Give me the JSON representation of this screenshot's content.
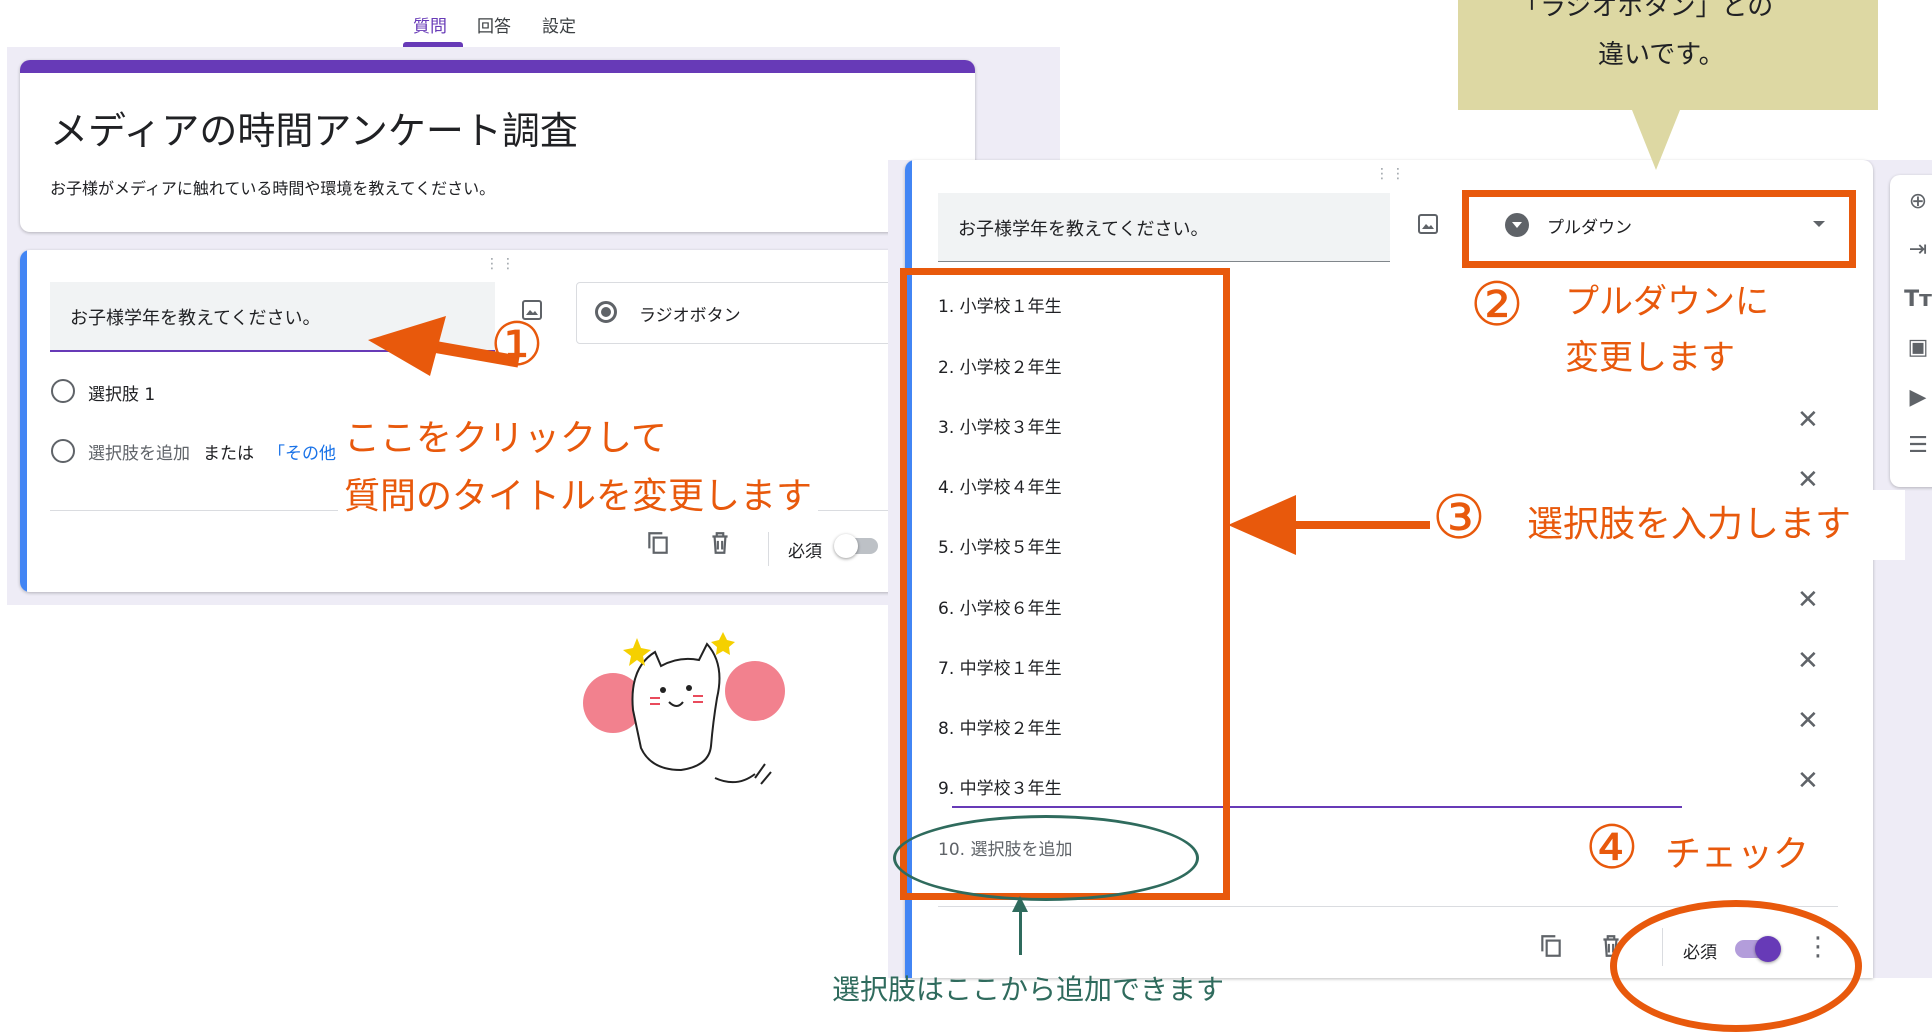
{
  "tabs": [
    {
      "label": "質問",
      "active": true
    },
    {
      "label": "回答",
      "active": false
    },
    {
      "label": "設定",
      "active": false
    }
  ],
  "form": {
    "title": "メディアの時間アンケート調査",
    "description": "お子様がメディアに触れている時間や環境を教えてください。",
    "drag_handle": "⋮⋮",
    "question_title": "お子様学年を教えてください。",
    "question_type": "ラジオボタン",
    "option1": "選択肢 1",
    "add_option": "選択肢を追加",
    "add_or": "または",
    "add_other": "「その他",
    "required_label": "必須",
    "required": false
  },
  "form_right": {
    "question_title": "お子様学年を教えてください。",
    "question_type": "プルダウン",
    "options": [
      {
        "num": "1.",
        "label": "小学校１年生"
      },
      {
        "num": "2.",
        "label": "小学校２年生"
      },
      {
        "num": "3.",
        "label": "小学校３年生"
      },
      {
        "num": "4.",
        "label": "小学校４年生"
      },
      {
        "num": "5.",
        "label": "小学校５年生"
      },
      {
        "num": "6.",
        "label": "小学校６年生"
      },
      {
        "num": "7.",
        "label": "中学校１年生"
      },
      {
        "num": "8.",
        "label": "中学校２年生"
      },
      {
        "num": "9.",
        "label": "中学校３年生"
      }
    ],
    "add_option_num": "10.",
    "add_option": "選択肢を追加",
    "required_label": "必須",
    "required": true,
    "remove_glyph": "✕"
  },
  "annotations": {
    "click_line1": "ここをクリックして",
    "click_line2": "質問のタイトルを変更します",
    "step1_num": "①",
    "step2_num": "②",
    "step2_line1": "プルダウンに",
    "step2_line2": "変更します",
    "step3_num": "③",
    "step3": "選択肢を入力します",
    "step4_num": "④",
    "step4": "チェック",
    "add_hint": "選択肢はここから追加できます",
    "callout_line1": "「ラジオボタン」との",
    "callout_line2": "違いです。"
  },
  "icons": {
    "image": "image-icon",
    "copy": "copy-icon",
    "trash": "trash-icon",
    "more": "more-vert-icon",
    "add_question": "add-circle-icon",
    "import": "import-icon",
    "title": "title-text-icon",
    "add_image": "image-icon",
    "video": "video-icon",
    "section": "section-icon"
  },
  "colors": {
    "accent": "#673ab7",
    "annotation": "#e8590c",
    "hint": "#2f6b5d",
    "callout": "#ddd8a3"
  }
}
